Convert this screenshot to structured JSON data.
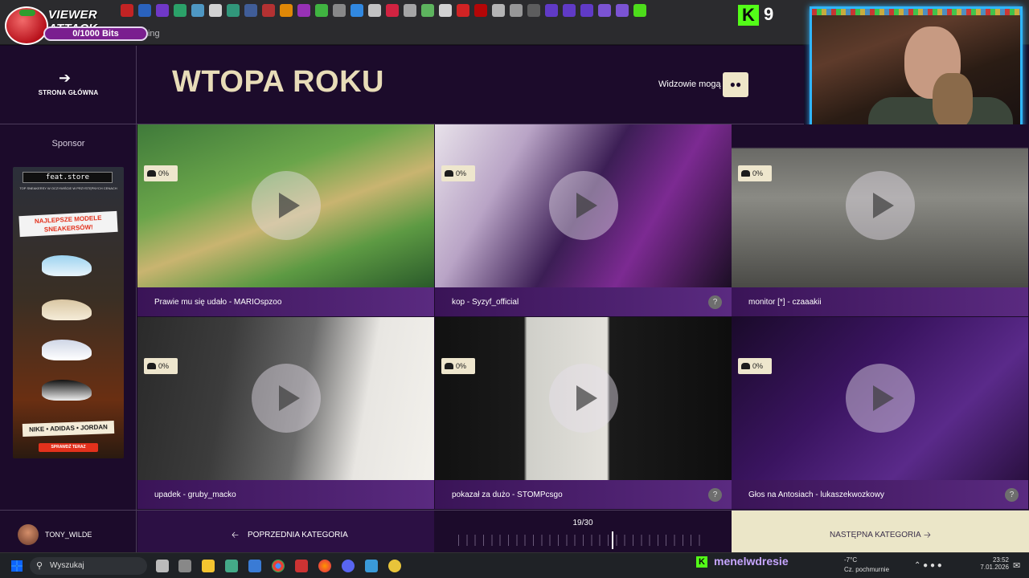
{
  "viewer_attack": {
    "title": "VIEWER ATTACK",
    "progress_text": "0/1000 Bits"
  },
  "browser": {
    "tab_fragment": "Ring"
  },
  "kick_overlay": {
    "count": "9"
  },
  "header": {
    "home_label": "STRONA GŁÓWNA",
    "title": "WTOPA ROKU",
    "viewers_label": "Widzowie mogą"
  },
  "sidebar": {
    "sponsor_label": "Sponsor",
    "ad": {
      "brand": "feat.store",
      "tagline": "TOP SNEAKERSY W OCZYWIŚCIE W PRZYSTĘPNYCH CENACH",
      "headline": "NAJLEPSZE MODELE SNEAKERSÓW!",
      "brands": "NIKE • ADIDAS • JORDAN",
      "cta": "SPRAWDŹ TERAZ"
    }
  },
  "clips": [
    {
      "caption": "Prawie mu się udało - MARIOspzoo",
      "percent": "0%",
      "has_help": false
    },
    {
      "caption": "kop - Syzyf_official",
      "percent": "0%",
      "has_help": true
    },
    {
      "caption": "monitor [*] - czaaakii",
      "percent": "0%",
      "has_help": false
    },
    {
      "caption": "upadek - gruby_macko",
      "percent": "0%",
      "has_help": false
    },
    {
      "caption": "pokazał za dużo - STOMPcsgo",
      "percent": "0%",
      "has_help": true
    },
    {
      "caption": "Głos na Antosiach - lukaszekwozkowy",
      "percent": "0%",
      "has_help": true
    }
  ],
  "footer": {
    "username": "TONY_WILDE",
    "prev_label": "POPRZEDNIA KATEGORIA",
    "progress_text": "19/30",
    "progress": {
      "current": 19,
      "total": 30
    },
    "next_label": "NASTĘPNA KATEGORIA"
  },
  "taskbar": {
    "search_placeholder": "Wyszukaj",
    "kick_username": "menelwdresie",
    "weather_temp": "-7°C",
    "weather_desc": "Cz. pochmurnie",
    "time": "23:52",
    "date": "7.01.2026"
  },
  "colors": {
    "accent_cream": "#efe6c8",
    "bg_purple": "#1c0b2b",
    "kick_green": "#53fc18",
    "title_cream": "#e8dcb8"
  }
}
